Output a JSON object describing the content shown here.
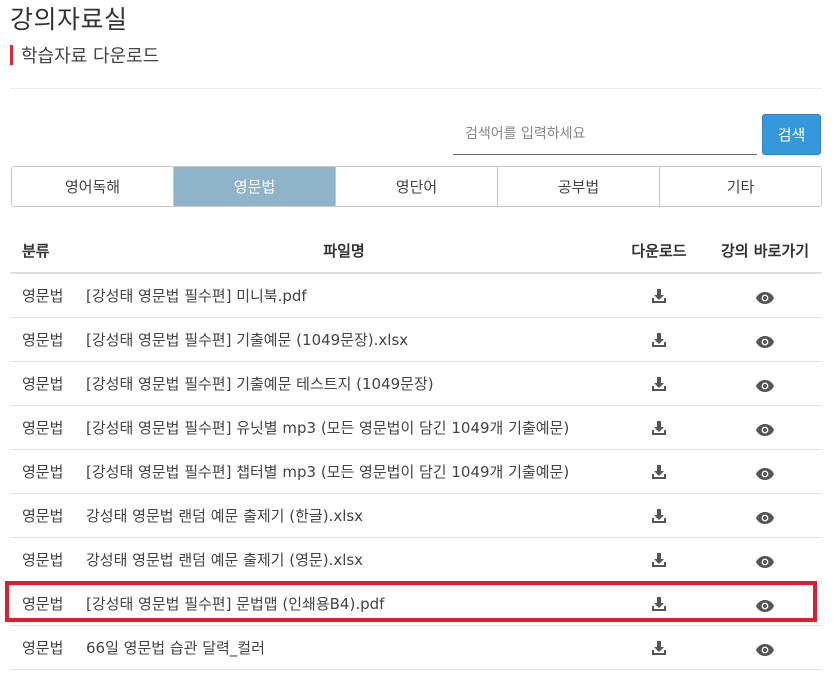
{
  "header": {
    "title": "강의자료실",
    "subtitle": "학습자료 다운로드"
  },
  "search": {
    "placeholder": "검색어를 입력하세요",
    "value": "",
    "button_label": "검색"
  },
  "tabs": [
    {
      "label": "영어독해",
      "active": false
    },
    {
      "label": "영문법",
      "active": true
    },
    {
      "label": "영단어",
      "active": false
    },
    {
      "label": "공부법",
      "active": false
    },
    {
      "label": "기타",
      "active": false
    }
  ],
  "table": {
    "headers": {
      "category": "분류",
      "filename": "파일명",
      "download": "다운로드",
      "shortcut": "강의 바로가기"
    },
    "rows": [
      {
        "category": "영문법",
        "filename": "[강성태 영문법 필수편] 미니북.pdf"
      },
      {
        "category": "영문법",
        "filename": "[강성태 영문법 필수편] 기출예문 (1049문장).xlsx"
      },
      {
        "category": "영문법",
        "filename": "[강성태 영문법 필수편] 기출예문 테스트지 (1049문장)"
      },
      {
        "category": "영문법",
        "filename": "[강성태 영문법 필수편] 유닛별 mp3 (모든 영문법이 담긴 1049개 기출예문)"
      },
      {
        "category": "영문법",
        "filename": "[강성태 영문법 필수편] 챕터별 mp3 (모든 영문법이 담긴 1049개 기출예문)"
      },
      {
        "category": "영문법",
        "filename": "강성태 영문법 랜덤 예문 출제기 (한글).xlsx"
      },
      {
        "category": "영문법",
        "filename": "강성태 영문법 랜덤 예문 출제기 (영문).xlsx"
      },
      {
        "category": "영문법",
        "filename": "[강성태 영문법 필수편] 문법맵 (인쇄용B4).pdf"
      },
      {
        "category": "영문법",
        "filename": "66일 영문법 습관 달력_컬러"
      }
    ]
  },
  "icons": {
    "download": "download-icon",
    "view": "eye-icon"
  },
  "colors": {
    "accent": "#3498db",
    "active_tab": "#8fb3c9",
    "title_bar": "#e0242b",
    "highlight": "#e21c2c"
  }
}
